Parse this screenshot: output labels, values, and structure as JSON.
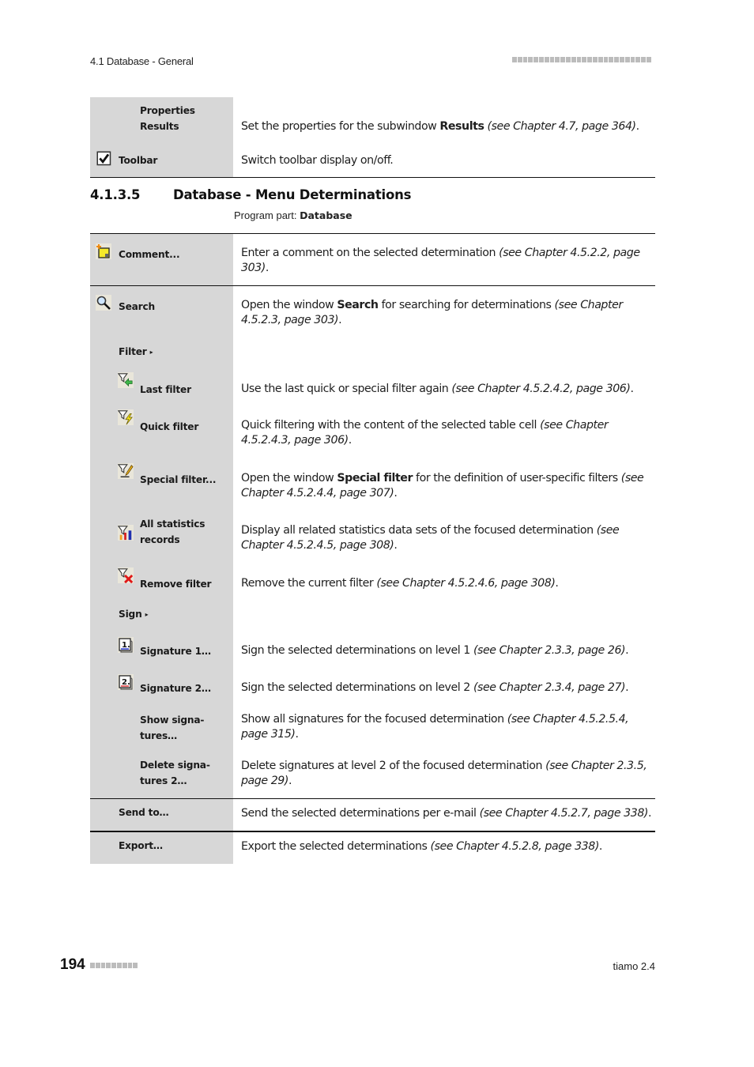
{
  "header": {
    "section": "4.1 Database - General"
  },
  "top_table": {
    "rows": [
      {
        "label_line1": "Properties",
        "label_line2": "Results",
        "desc_pre": "Set the properties for the subwindow ",
        "desc_bold": "Results",
        "desc_ref": "(see Chapter 4.7, page 364)",
        "desc_post": "."
      },
      {
        "icon": "checkbox-checked-icon",
        "label": "Toolbar",
        "desc_pre": "Switch toolbar display on/off."
      }
    ]
  },
  "section": {
    "number": "4.1.3.5",
    "title": "Database - Menu Determinations",
    "program_part_label": "Program part: ",
    "program_part_value": "Database"
  },
  "menu": {
    "comment": {
      "icon": "comment-icon",
      "label": "Comment...",
      "desc_pre": "Enter a comment on the selected determination ",
      "desc_ref": "(see Chapter 4.5.2.2, page 303)",
      "desc_post": "."
    },
    "search": {
      "icon": "search-icon",
      "label": "Search",
      "desc_pre": "Open the window ",
      "desc_bold": "Search",
      "desc_mid": " for searching for determinations ",
      "desc_ref": "(see Chapter 4.5.2.3, page 303)",
      "desc_post": "."
    },
    "filter": {
      "label": "Filter",
      "arrow": "▸"
    },
    "last_filter": {
      "icon": "last-filter-icon",
      "label": "Last filter",
      "desc_pre": "Use the last quick or special filter again ",
      "desc_ref": "(see Chapter 4.5.2.4.2, page 306)",
      "desc_post": "."
    },
    "quick_filter": {
      "icon": "quick-filter-icon",
      "label": "Quick filter",
      "desc_pre": "Quick filtering with the content of the selected table cell ",
      "desc_ref": "(see Chapter 4.5.2.4.3, page 306)",
      "desc_post": "."
    },
    "special_filter": {
      "icon": "special-filter-icon",
      "label": "Special filter...",
      "desc_pre": "Open the window ",
      "desc_bold": "Special filter",
      "desc_mid": " for the definition of user-specific filters ",
      "desc_ref": "(see Chapter 4.5.2.4.4, page 307)",
      "desc_post": "."
    },
    "all_statistics": {
      "icon": "statistics-filter-icon",
      "label_line1": "All statistics",
      "label_line2": "records",
      "desc_pre": "Display all related statistics data sets of the focused determination ",
      "desc_ref": "(see Chapter 4.5.2.4.5, page 308)",
      "desc_post": "."
    },
    "remove_filter": {
      "icon": "remove-filter-icon",
      "label": "Remove filter",
      "desc_pre": "Remove the current filter ",
      "desc_ref": "(see Chapter 4.5.2.4.6, page 308)",
      "desc_post": "."
    },
    "sign": {
      "label": "Sign",
      "arrow": "▸"
    },
    "signature1": {
      "icon": "signature-1-icon",
      "label": "Signature 1…",
      "desc_pre": "Sign the selected determinations on level 1 ",
      "desc_ref": "(see Chapter 2.3.3, page 26)",
      "desc_post": "."
    },
    "signature2": {
      "icon": "signature-2-icon",
      "label": "Signature 2…",
      "desc_pre": "Sign the selected determinations on level 2 ",
      "desc_ref": "(see Chapter 2.3.4, page 27)",
      "desc_post": "."
    },
    "show_signatures": {
      "label_line1": "Show signa-",
      "label_line2": "tures…",
      "desc_pre": "Show all signatures for the focused determination ",
      "desc_ref": "(see Chapter 4.5.2.5.4, page 315)",
      "desc_post": "."
    },
    "delete_signatures": {
      "label_line1": "Delete signa-",
      "label_line2": "tures 2…",
      "desc_pre": "Delete signatures at level 2 of the focused determination ",
      "desc_ref": "(see Chapter 2.3.5, page 29)",
      "desc_post": "."
    },
    "send_to": {
      "label": "Send to…",
      "desc_pre": "Send the selected determinations per e-mail ",
      "desc_ref": "(see Chapter 4.5.2.7, page 338)",
      "desc_post": "."
    },
    "export": {
      "label": "Export…",
      "desc_pre": "Export the selected determinations ",
      "desc_ref": "(see Chapter 4.5.2.8, page 338)",
      "desc_post": "."
    }
  },
  "footer": {
    "page_number": "194",
    "product": "tiamo 2.4"
  }
}
